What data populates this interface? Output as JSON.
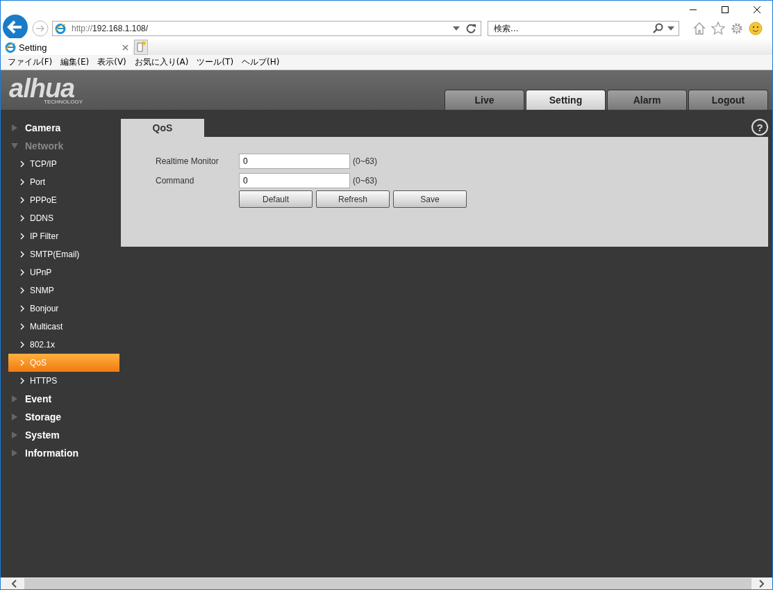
{
  "browser": {
    "address": {
      "scheme": "http://",
      "host": "192.168.1.108/"
    },
    "search": {
      "placeholder": "検索..."
    },
    "tabs": [
      {
        "label": "Setting",
        "selected": true
      }
    ],
    "menu": [
      "ファイル(F)",
      "編集(E)",
      "表示(V)",
      "お気に入り(A)",
      "ツール(T)",
      "ヘルプ(H)"
    ]
  },
  "header": {
    "logo": "alhua",
    "logo_sub": "TECHNOLOGY",
    "tabs": [
      {
        "label": "Live",
        "selected": false
      },
      {
        "label": "Setting",
        "selected": true
      },
      {
        "label": "Alarm",
        "selected": false
      },
      {
        "label": "Logout",
        "selected": false
      }
    ]
  },
  "sidebar": [
    {
      "label": "Camera",
      "expanded": false
    },
    {
      "label": "Network",
      "expanded": true,
      "children": [
        {
          "label": "TCP/IP",
          "selected": false
        },
        {
          "label": "Port",
          "selected": false
        },
        {
          "label": "PPPoE",
          "selected": false
        },
        {
          "label": "DDNS",
          "selected": false
        },
        {
          "label": "IP Filter",
          "selected": false
        },
        {
          "label": "SMTP(Email)",
          "selected": false
        },
        {
          "label": "UPnP",
          "selected": false
        },
        {
          "label": "SNMP",
          "selected": false
        },
        {
          "label": "Bonjour",
          "selected": false
        },
        {
          "label": "Multicast",
          "selected": false
        },
        {
          "label": "802.1x",
          "selected": false
        },
        {
          "label": "QoS",
          "selected": true
        },
        {
          "label": "HTTPS",
          "selected": false
        }
      ]
    },
    {
      "label": "Event",
      "expanded": false
    },
    {
      "label": "Storage",
      "expanded": false
    },
    {
      "label": "System",
      "expanded": false
    },
    {
      "label": "Information",
      "expanded": false
    }
  ],
  "panel": {
    "tab": "QoS",
    "help": "?",
    "fields": [
      {
        "label": "Realtime Monitor",
        "value": "0",
        "range": "(0~63)"
      },
      {
        "label": "Command",
        "value": "0",
        "range": "(0~63)"
      }
    ],
    "buttons": [
      "Default",
      "Refresh",
      "Save"
    ]
  }
}
